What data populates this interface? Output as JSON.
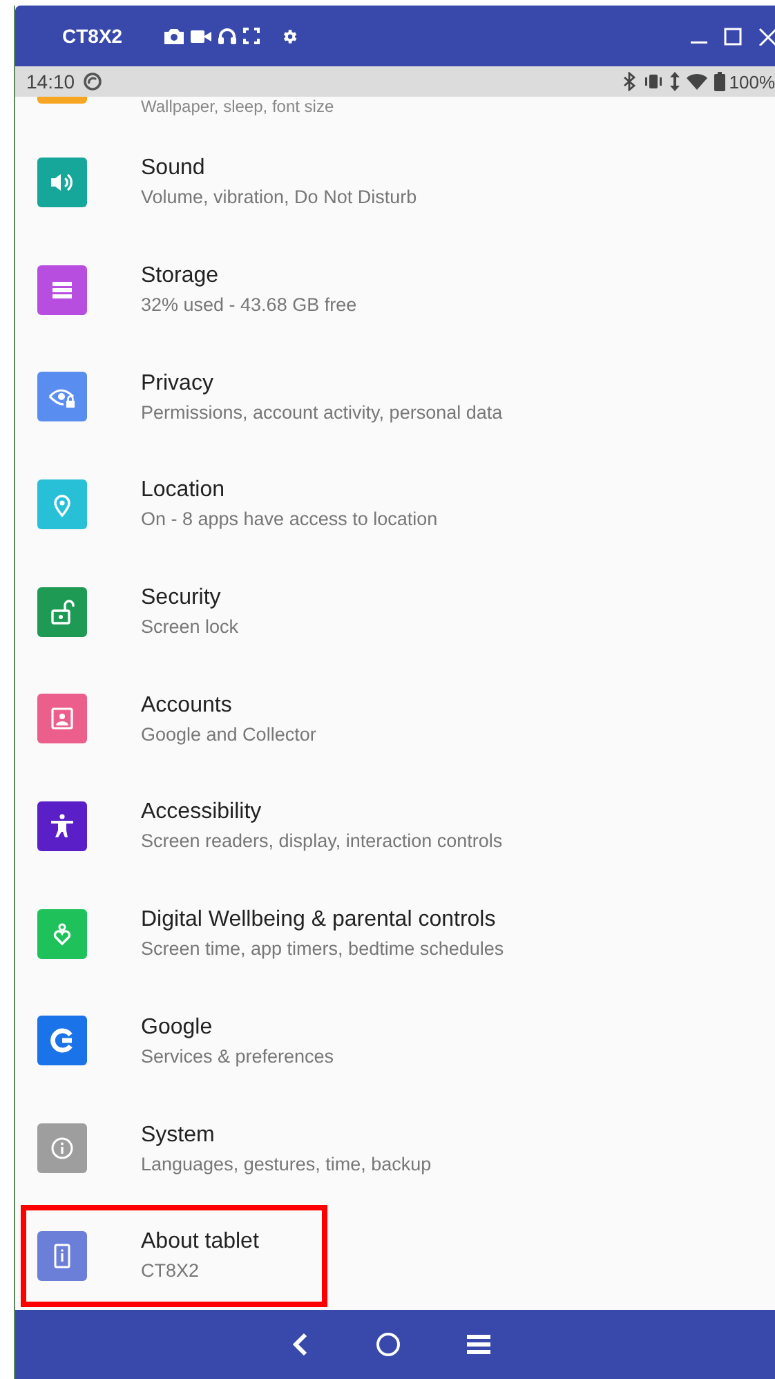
{
  "window": {
    "title": "CT8X2"
  },
  "status_bar": {
    "time": "14:10",
    "battery": "100%"
  },
  "partial_item": {
    "subtitle": "Wallpaper, sleep, font size",
    "color": "#f6a623"
  },
  "items": [
    {
      "kind": "sound",
      "title": "Sound",
      "subtitle": "Volume, vibration, Do Not Disturb",
      "color": "#16a69a",
      "highlighted": false
    },
    {
      "kind": "storage",
      "title": "Storage",
      "subtitle": "32% used - 43.68 GB free",
      "color": "#b74ee0",
      "highlighted": false
    },
    {
      "kind": "privacy",
      "title": "Privacy",
      "subtitle": "Permissions, account activity, personal data",
      "color": "#5a8df0",
      "highlighted": false
    },
    {
      "kind": "location",
      "title": "Location",
      "subtitle": "On - 8 apps have access to location",
      "color": "#27c0d6",
      "highlighted": false
    },
    {
      "kind": "security",
      "title": "Security",
      "subtitle": "Screen lock",
      "color": "#1f9a55",
      "highlighted": false
    },
    {
      "kind": "accounts",
      "title": "Accounts",
      "subtitle": "Google and Collector",
      "color": "#ec5f8c",
      "highlighted": false
    },
    {
      "kind": "accessibility",
      "title": "Accessibility",
      "subtitle": "Screen readers, display, interaction controls",
      "color": "#5a1fc6",
      "highlighted": false
    },
    {
      "kind": "wellbeing",
      "title": "Digital Wellbeing & parental controls",
      "subtitle": "Screen time, app timers, bedtime schedules",
      "color": "#1fc25a",
      "highlighted": false
    },
    {
      "kind": "google",
      "title": "Google",
      "subtitle": "Services & preferences",
      "color": "#1a73e8",
      "highlighted": false
    },
    {
      "kind": "system",
      "title": "System",
      "subtitle": "Languages, gestures, time, backup",
      "color": "#9e9e9e",
      "highlighted": false
    },
    {
      "kind": "about",
      "title": "About tablet",
      "subtitle": "CT8X2",
      "color": "#6b7fd8",
      "highlighted": true
    }
  ]
}
